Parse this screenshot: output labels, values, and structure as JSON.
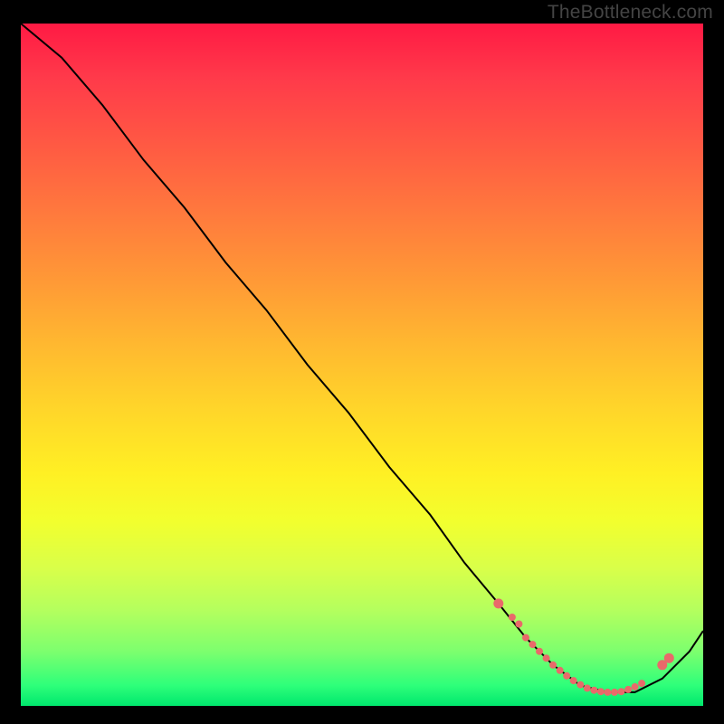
{
  "watermark": "TheBottleneck.com",
  "colors": {
    "frame": "#000000",
    "gradient_top": "#ff1a44",
    "gradient_bottom": "#00e76d",
    "curve": "#000000",
    "dot": "#e96a6a"
  },
  "chart_data": {
    "type": "line",
    "title": "",
    "xlabel": "",
    "ylabel": "",
    "xlim": [
      0,
      100
    ],
    "ylim": [
      0,
      100
    ],
    "x": [
      0,
      6,
      12,
      18,
      24,
      30,
      36,
      42,
      48,
      54,
      60,
      65,
      70,
      74,
      78,
      82,
      86,
      90,
      94,
      98,
      100
    ],
    "values": [
      100,
      95,
      88,
      80,
      73,
      65,
      58,
      50,
      43,
      35,
      28,
      21,
      15,
      10,
      6,
      3,
      2,
      2,
      4,
      8,
      11
    ],
    "highlight_dots": {
      "x": [
        70,
        72,
        73,
        74,
        75,
        76,
        77,
        78,
        79,
        80,
        81,
        82,
        83,
        84,
        85,
        86,
        87,
        88,
        89,
        90,
        91,
        94,
        95
      ],
      "y": [
        15,
        13,
        12,
        10,
        9,
        8,
        7,
        6,
        5.2,
        4.4,
        3.7,
        3.1,
        2.6,
        2.3,
        2.1,
        2.0,
        2.0,
        2.1,
        2.4,
        2.8,
        3.3,
        6.0,
        7.0
      ]
    }
  }
}
